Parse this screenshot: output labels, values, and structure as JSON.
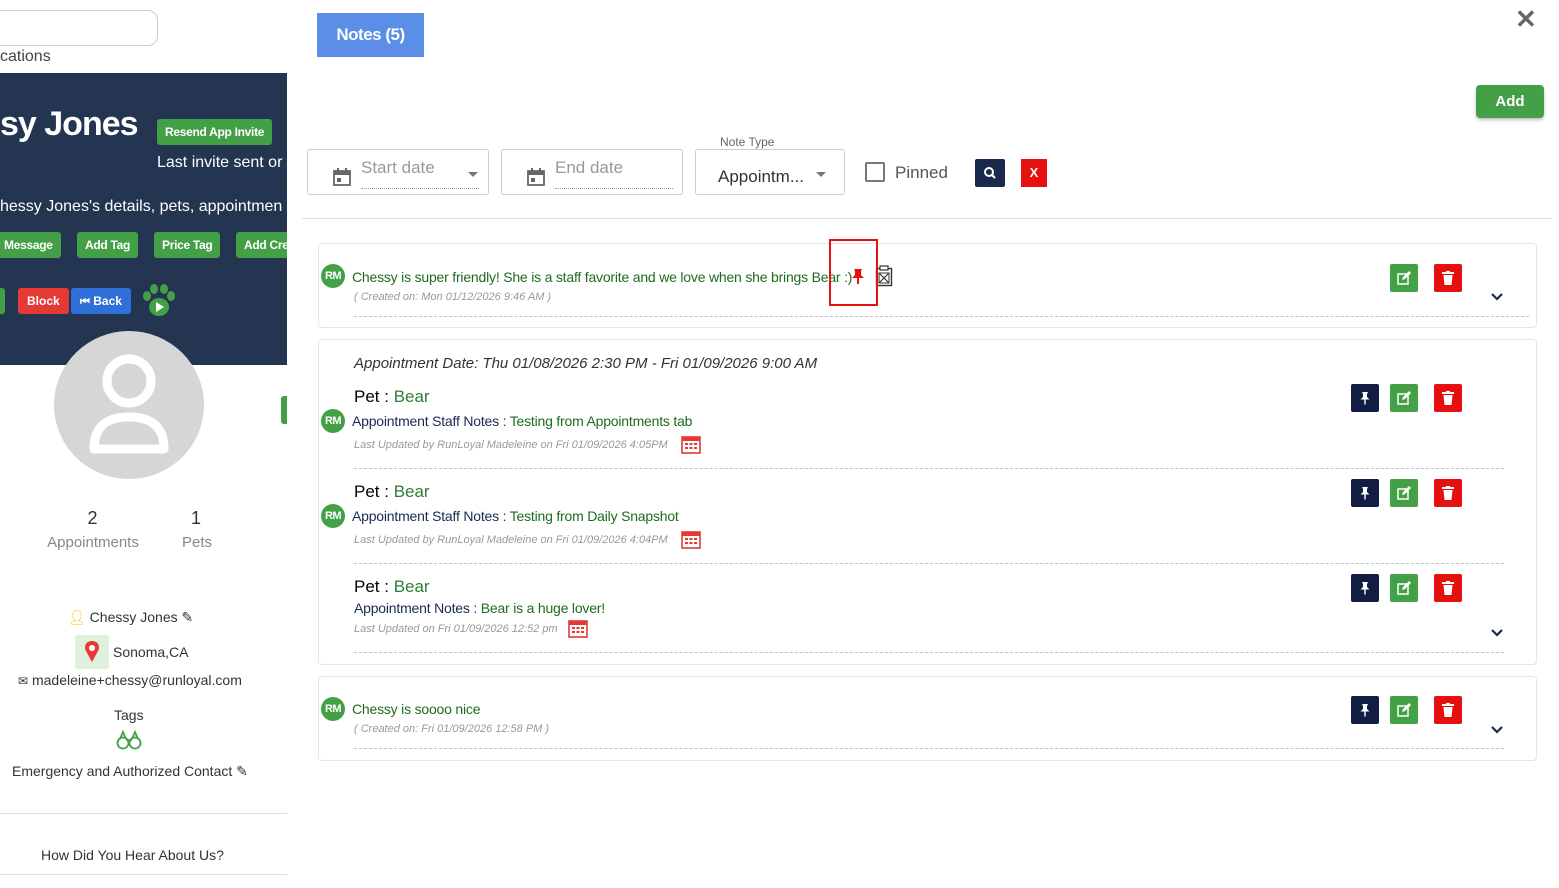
{
  "background": {
    "search_suffix": "cations",
    "client_name_partial": "sy Jones",
    "resend_label": "Resend App Invite",
    "invite_text": "Last invite sent or",
    "description": "hessy Jones's details, pets, appointmen",
    "buttons": {
      "message": "Message",
      "add_tag": "Add Tag",
      "price_tag": "Price Tag",
      "add_cre": "Add Cre",
      "block": "Block",
      "back": "Back"
    },
    "stats": {
      "appointments_count": "2",
      "appointments_label": "Appointments",
      "pets_count": "1",
      "pets_label": "Pets"
    },
    "owner_name": "Chessy Jones",
    "location": "Sonoma,CA",
    "email": "madeleine+chessy@runloyal.com",
    "tags_label": "Tags",
    "emergency_label": "Emergency and Authorized Contact",
    "hear_about_label": "How Did You Hear About Us?"
  },
  "modal": {
    "tab_label": "Notes (5)",
    "close_glyph": "✕",
    "add_label": "Add",
    "filters": {
      "start_placeholder": "Start date",
      "end_placeholder": "End date",
      "note_type_label": "Note Type",
      "note_type_value": "Appointm...",
      "pinned_label": "Pinned",
      "clear_glyph": "X"
    },
    "notes": {
      "first": {
        "avatar": "RM",
        "text": "Chessy is super friendly! She is a staff favorite and we love when she brings Bear :)",
        "meta": "( Created on: Mon 01/12/2026 9:46 AM )"
      },
      "appointment": {
        "date_line": "Appointment Date: Thu 01/08/2026 2:30 PM - Fri 01/09/2026 9:00 AM",
        "items": [
          {
            "pet_label": "Pet : ",
            "pet_name": "Bear",
            "avatar": "RM",
            "note_label": "Appointment Staff Notes : ",
            "note_text": "Testing from Appointments tab",
            "meta": "Last Updated by RunLoyal Madeleine on Fri 01/09/2026 4:05PM"
          },
          {
            "pet_label": "Pet : ",
            "pet_name": "Bear",
            "avatar": "RM",
            "note_label": "Appointment Staff Notes : ",
            "note_text": "Testing from Daily Snapshot",
            "meta": "Last Updated by RunLoyal Madeleine on Fri 01/09/2026 4:04PM"
          },
          {
            "pet_label": "Pet : ",
            "pet_name": "Bear",
            "note_label": "Appointment Notes : ",
            "note_text": "Bear is a huge lover!",
            "meta": "Last Updated on Fri 01/09/2026 12:52 pm"
          }
        ]
      },
      "last": {
        "avatar": "RM",
        "text": "Chessy is soooo nice",
        "meta": "( Created on: Fri 01/09/2026 12:58 PM )"
      }
    }
  },
  "colors": {
    "green": "#43a047",
    "red": "#e51010",
    "navy": "#111d42",
    "tab_blue": "#5b8ee6",
    "banner": "#233550"
  }
}
